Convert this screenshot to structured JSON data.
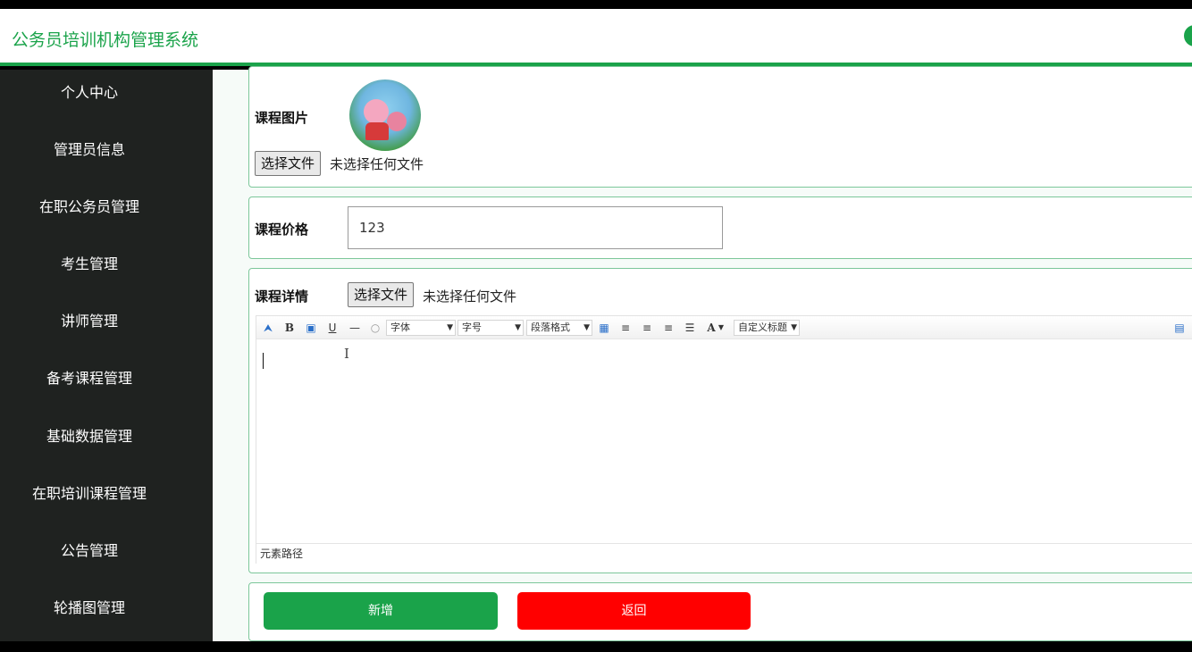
{
  "header": {
    "title": "公务员培训机构管理系统"
  },
  "sidebar": {
    "items": [
      {
        "label": "个人中心"
      },
      {
        "label": "管理员信息"
      },
      {
        "label": "在职公务员管理"
      },
      {
        "label": "考生管理"
      },
      {
        "label": "讲师管理"
      },
      {
        "label": "备考课程管理"
      },
      {
        "label": "基础数据管理"
      },
      {
        "label": "在职培训课程管理"
      },
      {
        "label": "公告管理"
      },
      {
        "label": "轮播图管理"
      }
    ]
  },
  "form": {
    "image": {
      "label": "课程图片",
      "file_button": "选择文件",
      "file_status": "未选择任何文件"
    },
    "price": {
      "label": "课程价格",
      "value": "123"
    },
    "detail": {
      "label": "课程详情",
      "file_button": "选择文件",
      "file_status": "未选择任何文件",
      "toolbar": {
        "bold": "B",
        "underline": "U",
        "font_family": "字体",
        "font_size": "字号",
        "paragraph": "段落格式",
        "font_color": "A",
        "custom_title": "自定义标题"
      },
      "element_path": "元素路径"
    }
  },
  "actions": {
    "add_label": "新增",
    "back_label": "返回"
  },
  "colors": {
    "brand_green": "#1aa34a",
    "danger_red": "#ff0000",
    "sidebar_bg": "#1f2220"
  }
}
